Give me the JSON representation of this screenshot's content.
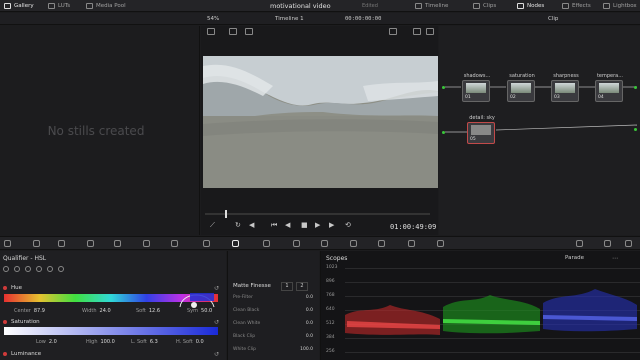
{
  "topbar": {
    "gallery": "Gallery",
    "luts": "LUTs",
    "media_pool": "Media Pool",
    "project_title": "motivational video",
    "status": "Edited",
    "timeline": "Timeline",
    "clips": "Clips",
    "nodes": "Nodes",
    "effects": "Effects",
    "lightbox": "Lightbox"
  },
  "viewer": {
    "zoom": "54%",
    "timeline_name": "Timeline 1",
    "timecode_top": "00:00:00:00",
    "timecode": "01:00:49:09",
    "clip_menu": "Clip"
  },
  "gallery": {
    "empty_text": "No stills created"
  },
  "nodes": [
    {
      "label": "shadows...",
      "num": "01"
    },
    {
      "label": "saturation",
      "num": "02"
    },
    {
      "label": "sharpness",
      "num": "03"
    },
    {
      "label": "tempera...",
      "num": "04"
    },
    {
      "label": "detail: sky",
      "num": "05"
    }
  ],
  "qualifier": {
    "title": "Qualifier - HSL",
    "hue_label": "Hue",
    "hue": {
      "center_label": "Center",
      "center": "87.9",
      "width_label": "Width",
      "width": "24.0",
      "soft_label": "Soft",
      "soft": "12.6",
      "sym_label": "Sym",
      "sym": "50.0"
    },
    "saturation_label": "Saturation",
    "sat": {
      "low_label": "Low",
      "low": "2.0",
      "high_label": "High",
      "high": "100.0",
      "lsoft_label": "L. Soft",
      "lsoft": "6.3",
      "hsoft_label": "H. Soft",
      "hsoft": "0.0"
    },
    "luminance_label": "Luminance"
  },
  "matte": {
    "title": "Matte Finesse",
    "tab1": "1",
    "tab2": "2",
    "rows": [
      {
        "label": "Pre-Filter",
        "value": "0.0"
      },
      {
        "label": "Clean Black",
        "value": "0.0"
      },
      {
        "label": "Clean White",
        "value": "0.0"
      },
      {
        "label": "Black Clip",
        "value": "0.0"
      },
      {
        "label": "White Clip",
        "value": "100.0"
      }
    ]
  },
  "scopes": {
    "title": "Scopes",
    "mode": "Parade",
    "ticks": [
      "1023",
      "896",
      "768",
      "640",
      "512",
      "384",
      "256"
    ]
  }
}
